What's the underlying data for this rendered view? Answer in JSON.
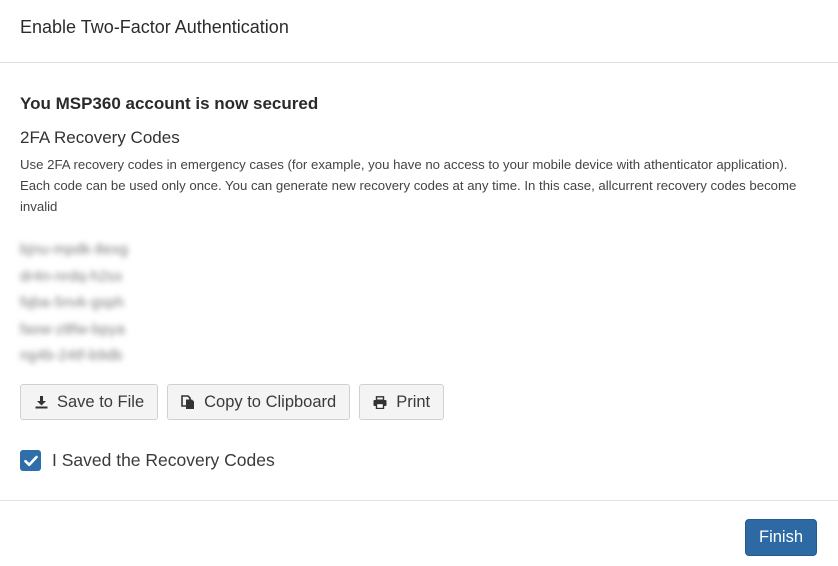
{
  "dialog": {
    "title": "Enable Two-Factor Authentication"
  },
  "content": {
    "secured_title": "You MSP360 account is now secured",
    "codes_title": "2FA Recovery Codes",
    "description": "Use 2FA recovery codes in emergency cases (for example, you have no access to your mobile device with athenticator application). Each code can be used only once. You can generate new recovery codes at any time. In this case, allcurrent recovery codes become invalid",
    "codes": [
      "bjnu-mpdk-8exg",
      "dr4n-nrdq-h2sx",
      "fqba-5nvk-gsph",
      "faxw-z8fw-bpya",
      "ng4b-24tf-b9db"
    ]
  },
  "actions": {
    "save_label": "Save to File",
    "save_icon": "download-icon",
    "copy_label": "Copy to Clipboard",
    "copy_icon": "copy-icon",
    "print_label": "Print",
    "print_icon": "print-icon"
  },
  "confirm": {
    "label": "I Saved the Recovery Codes",
    "checked": true
  },
  "footer": {
    "finish_label": "Finish"
  },
  "colors": {
    "primary": "#2d6aa3",
    "checkbox": "#2f6ea8",
    "button_bg": "#f4f4f4"
  }
}
